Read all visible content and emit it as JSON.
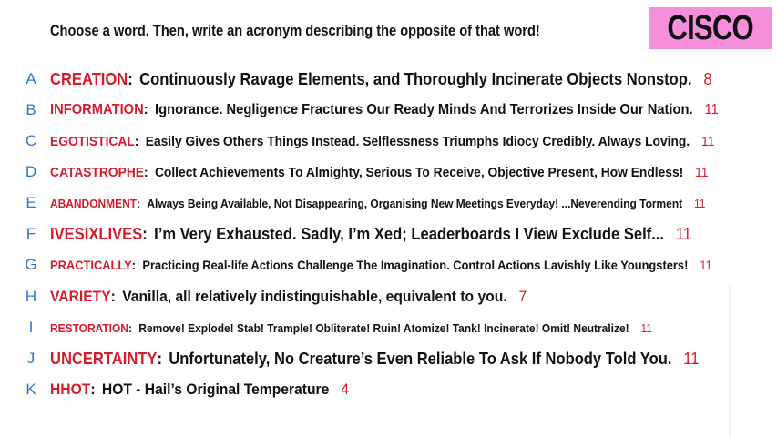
{
  "prompt": "Choose a word. Then, write an acronym describing the opposite of that word!",
  "badge": {
    "text": "CISCO",
    "color": "#f78fdf"
  },
  "colors": {
    "letter": "#2f74c6",
    "word": "#d51c2a",
    "number": "#d51c2a"
  },
  "rows": [
    {
      "letter": "A",
      "word": "CREATION",
      "acronym": "Continuously Ravage Elements, and Thoroughly Incinerate Objects Nonstop.",
      "number": "8"
    },
    {
      "letter": "B",
      "word": "INFORMATION",
      "acronym": "Ignorance. Negligence Fractures Our Ready Minds And Terrorizes Inside Our Nation.",
      "number": "11"
    },
    {
      "letter": "C",
      "word": "EGOTISTICAL",
      "acronym": "Easily Gives Others Things Instead. Selflessness Triumphs Idiocy Credibly. Always Loving.",
      "number": "11"
    },
    {
      "letter": "D",
      "word": "CATASTROPHE",
      "acronym": "Collect Achievements To Almighty, Serious To Receive, Objective Present, How Endless!",
      "number": "11"
    },
    {
      "letter": "E",
      "word": "ABANDONMENT",
      "acronym": "Always Being Available, Not Disappearing, Organising New Meetings Everyday! ...Neverending Torment",
      "number": "11"
    },
    {
      "letter": "F",
      "word": "IVESIXLIVES",
      "acronym": "I’m Very Exhausted. Sadly, I’m Xed; Leaderboards I View Exclude Self...",
      "number": "11"
    },
    {
      "letter": "G",
      "word": "PRACTICALLY",
      "acronym": "Practicing Real-life Actions Challenge The Imagination. Control Actions Lavishly Like Youngsters!",
      "number": "11"
    },
    {
      "letter": "H",
      "word": "VARIETY",
      "acronym": "Vanilla, all relatively indistinguishable, equivalent to you.",
      "number": "7"
    },
    {
      "letter": "I",
      "word": "RESTORATION",
      "acronym": "Remove! Explode! Stab! Trample! Obliterate! Ruin! Atomize! Tank! Incinerate! Omit! Neutralize!",
      "number": "11"
    },
    {
      "letter": "J",
      "word": "UNCERTAINTY",
      "acronym": "Unfortunately, No Creature’s Even Reliable To Ask If Nobody Told You.",
      "number": "11"
    },
    {
      "letter": "K",
      "word": "HHOT",
      "acronym": "HOT - Hail’s Original Temperature",
      "number": "4"
    }
  ]
}
